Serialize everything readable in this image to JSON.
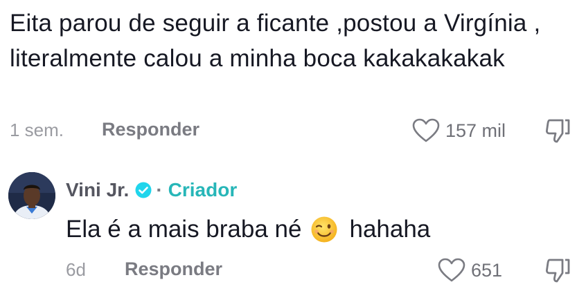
{
  "comment": {
    "text": "Eita parou de seguir a ficante ,postou a Virgínia , literalmente calou a minha boca kakakakakak",
    "time": "1 sem.",
    "reply_label": "Responder",
    "likes": "157 mil"
  },
  "reply": {
    "author": "Vini Jr.",
    "separator": "·",
    "badge": "Criador",
    "text_before_emoji": "Ela é a mais braba né",
    "emoji": "winking-face",
    "text_after_emoji": "hahaha",
    "time": "6d",
    "reply_label": "Responder",
    "likes": "651"
  },
  "colors": {
    "creator_accent": "#27b6b8",
    "verified_badge": "#20d5ec",
    "secondary_text": "#9a9ba1"
  },
  "icons": {
    "like": "heart-outline-icon",
    "dislike": "thumbs-down-outline-icon",
    "verified": "verified-check-icon"
  }
}
